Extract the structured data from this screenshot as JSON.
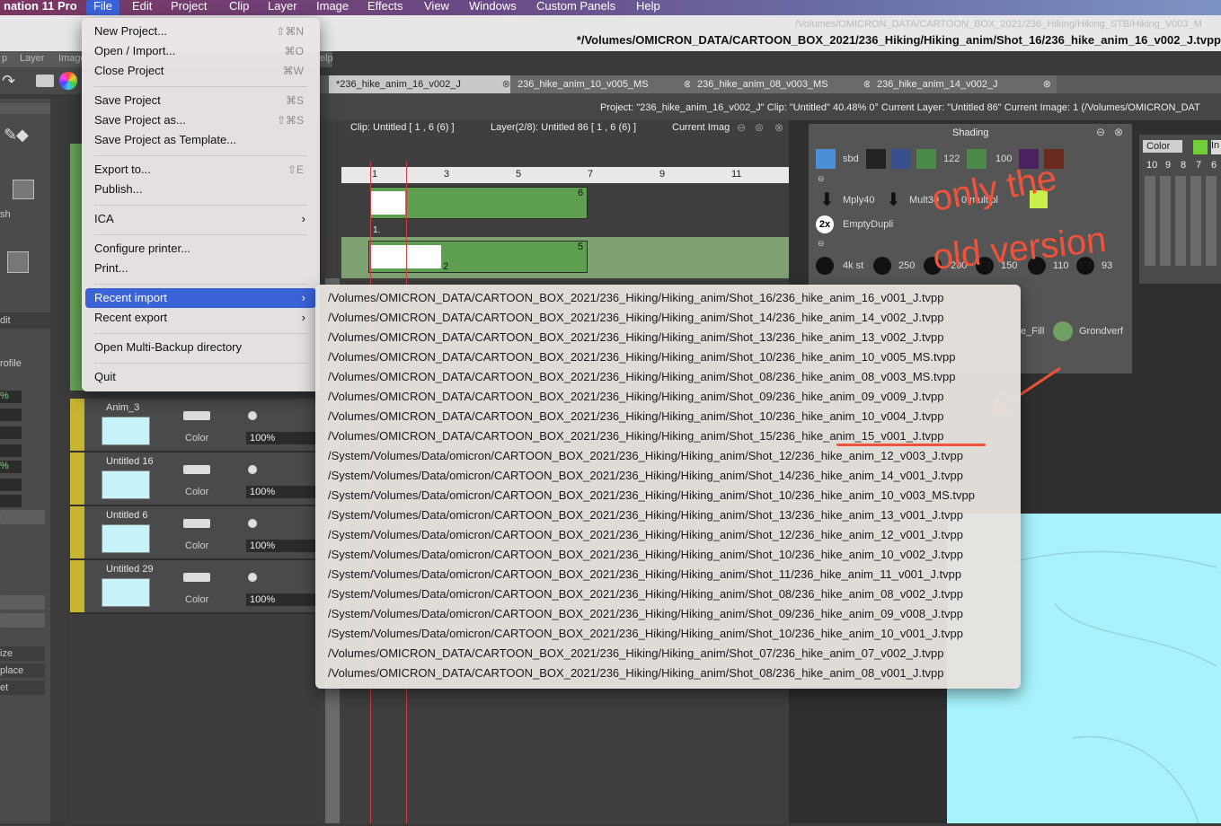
{
  "menubar": {
    "app_name": "nation 11 Pro",
    "items": [
      "File",
      "Edit",
      "Project",
      "Clip",
      "Layer",
      "Image",
      "Effects",
      "View",
      "Windows",
      "Custom Panels",
      "Help"
    ]
  },
  "window": {
    "title": "*/Volumes/OMICRON_DATA/CARTOON_BOX_2021/236_Hiking/Hiking_anim/Shot_16/236_hike_anim_16_v002_J.tvpp",
    "ghost_title": "/Volumes/OMICRON_DATA/CARTOON_BOX_2021/236_Hiking/Hiking_STB/Hiking_V003_M"
  },
  "left_toolbar": {
    "labels": [
      "p",
      "Layer",
      "Image",
      "elp"
    ]
  },
  "tabs": [
    {
      "label": "*236_hike_anim_16_v002_J",
      "active": true
    },
    {
      "label": "236_hike_anim_10_v005_MS",
      "active": false
    },
    {
      "label": "236_hike_anim_08_v003_MS",
      "active": false
    },
    {
      "label": "236_hike_anim_14_v002_J",
      "active": false
    }
  ],
  "infobar": {
    "project": "Project:  \"236_hike_anim_16_v002_J\"  Clip: \"Untitled\"   40.48%   0°   Current Layer: \"Untitled 86\"   Current Image: 1 (/Volumes/OMICRON_DAT"
  },
  "timeline": {
    "clip_label": "Clip: Untitled [ 1 , 6  (6) ]",
    "layer_label": "Layer(2/8): Untitled 86 [ 1 , 6  (6) ]",
    "current_image_label": "Current Imag",
    "ruler": [
      "1",
      "3",
      "5",
      "7",
      "9",
      "11"
    ],
    "bar1_end": "6",
    "bar2_end": "5",
    "bar2_mid": "2",
    "bar1_label": "1."
  },
  "left_panel": {
    "labels": [
      "sh",
      "dit",
      "rofile",
      "ize",
      "place",
      "et"
    ],
    "percents": [
      "%",
      "%"
    ]
  },
  "layers": [
    {
      "name": "Anim_3",
      "color": "Color",
      "opacity": "100%"
    },
    {
      "name": "Untitled 16",
      "color": "Color",
      "opacity": "100%"
    },
    {
      "name": "Untitled 6",
      "color": "Color",
      "opacity": "100%"
    },
    {
      "name": "Untitled 29",
      "color": "Color",
      "opacity": "100%"
    }
  ],
  "file_menu": {
    "items": [
      {
        "label": "New Project...",
        "shortcut": "⇧⌘N"
      },
      {
        "label": "Open / Import...",
        "shortcut": "⌘O"
      },
      {
        "label": "Close Project",
        "shortcut": "⌘W"
      },
      {
        "label": "Save Project",
        "shortcut": "⌘S"
      },
      {
        "label": "Save Project as...",
        "shortcut": "⇧⌘S"
      },
      {
        "label": "Save Project as Template...",
        "shortcut": ""
      },
      {
        "label": "Export to...",
        "shortcut": "⇧E"
      },
      {
        "label": "Publish...",
        "shortcut": ""
      },
      {
        "label": "ICA",
        "shortcut": ""
      },
      {
        "label": "Configure printer...",
        "shortcut": ""
      },
      {
        "label": "Print...",
        "shortcut": ""
      },
      {
        "label": "Recent import",
        "shortcut": ""
      },
      {
        "label": "Recent export",
        "shortcut": ""
      },
      {
        "label": "Open Multi-Backup directory",
        "shortcut": ""
      },
      {
        "label": "Quit",
        "shortcut": ""
      }
    ]
  },
  "recent_import": [
    "/Volumes/OMICRON_DATA/CARTOON_BOX_2021/236_Hiking/Hiking_anim/Shot_16/236_hike_anim_16_v001_J.tvpp",
    "/Volumes/OMICRON_DATA/CARTOON_BOX_2021/236_Hiking/Hiking_anim/Shot_14/236_hike_anim_14_v002_J.tvpp",
    "/Volumes/OMICRON_DATA/CARTOON_BOX_2021/236_Hiking/Hiking_anim/Shot_13/236_hike_anim_13_v002_J.tvpp",
    "/Volumes/OMICRON_DATA/CARTOON_BOX_2021/236_Hiking/Hiking_anim/Shot_10/236_hike_anim_10_v005_MS.tvpp",
    "/Volumes/OMICRON_DATA/CARTOON_BOX_2021/236_Hiking/Hiking_anim/Shot_08/236_hike_anim_08_v003_MS.tvpp",
    "/Volumes/OMICRON_DATA/CARTOON_BOX_2021/236_Hiking/Hiking_anim/Shot_09/236_hike_anim_09_v009_J.tvpp",
    "/Volumes/OMICRON_DATA/CARTOON_BOX_2021/236_Hiking/Hiking_anim/Shot_10/236_hike_anim_10_v004_J.tvpp",
    "/Volumes/OMICRON_DATA/CARTOON_BOX_2021/236_Hiking/Hiking_anim/Shot_15/236_hike_anim_15_v001_J.tvpp",
    "/System/Volumes/Data/omicron/CARTOON_BOX_2021/236_Hiking/Hiking_anim/Shot_12/236_hike_anim_12_v003_J.tvpp",
    "/System/Volumes/Data/omicron/CARTOON_BOX_2021/236_Hiking/Hiking_anim/Shot_14/236_hike_anim_14_v001_J.tvpp",
    "/System/Volumes/Data/omicron/CARTOON_BOX_2021/236_Hiking/Hiking_anim/Shot_10/236_hike_anim_10_v003_MS.tvpp",
    "/System/Volumes/Data/omicron/CARTOON_BOX_2021/236_Hiking/Hiking_anim/Shot_13/236_hike_anim_13_v001_J.tvpp",
    "/System/Volumes/Data/omicron/CARTOON_BOX_2021/236_Hiking/Hiking_anim/Shot_12/236_hike_anim_12_v001_J.tvpp",
    "/System/Volumes/Data/omicron/CARTOON_BOX_2021/236_Hiking/Hiking_anim/Shot_10/236_hike_anim_10_v002_J.tvpp",
    "/System/Volumes/Data/omicron/CARTOON_BOX_2021/236_Hiking/Hiking_anim/Shot_11/236_hike_anim_11_v001_J.tvpp",
    "/System/Volumes/Data/omicron/CARTOON_BOX_2021/236_Hiking/Hiking_anim/Shot_08/236_hike_anim_08_v002_J.tvpp",
    "/System/Volumes/Data/omicron/CARTOON_BOX_2021/236_Hiking/Hiking_anim/Shot_09/236_hike_anim_09_v008_J.tvpp",
    "/System/Volumes/Data/omicron/CARTOON_BOX_2021/236_Hiking/Hiking_anim/Shot_10/236_hike_anim_10_v001_J.tvpp",
    "/Volumes/OMICRON_DATA/CARTOON_BOX_2021/236_Hiking/Hiking_anim/Shot_07/236_hike_anim_07_v002_J.tvpp",
    "/Volumes/OMICRON_DATA/CARTOON_BOX_2021/236_Hiking/Hiking_anim/Shot_08/236_hike_anim_08_v001_J.tvpp"
  ],
  "shading_panel": {
    "title": "Shading",
    "row1": [
      "sbd",
      "122",
      "100"
    ],
    "row2": [
      "Mply40",
      "Mult30",
      "0 multipl"
    ],
    "row3": [
      "EmptyDupli"
    ],
    "row4": [
      "4k st",
      "250",
      "200",
      "150",
      "110",
      "93"
    ],
    "row5": [
      "e_Fill",
      "Grondverf"
    ],
    "badge": "2x"
  },
  "color_panel": {
    "title": "Color",
    "extra": "In",
    "numbers": [
      "10",
      "9",
      "8",
      "7",
      "6"
    ]
  },
  "annotation": {
    "text_line1": "only the",
    "text_line2": "old version",
    "color": "#f0533a"
  },
  "colors": {
    "accent": "#3a63d8",
    "timeline_green": "#5fa050",
    "layer_strip": "#c7b431",
    "canvas_cyan": "#a8f3fb"
  }
}
